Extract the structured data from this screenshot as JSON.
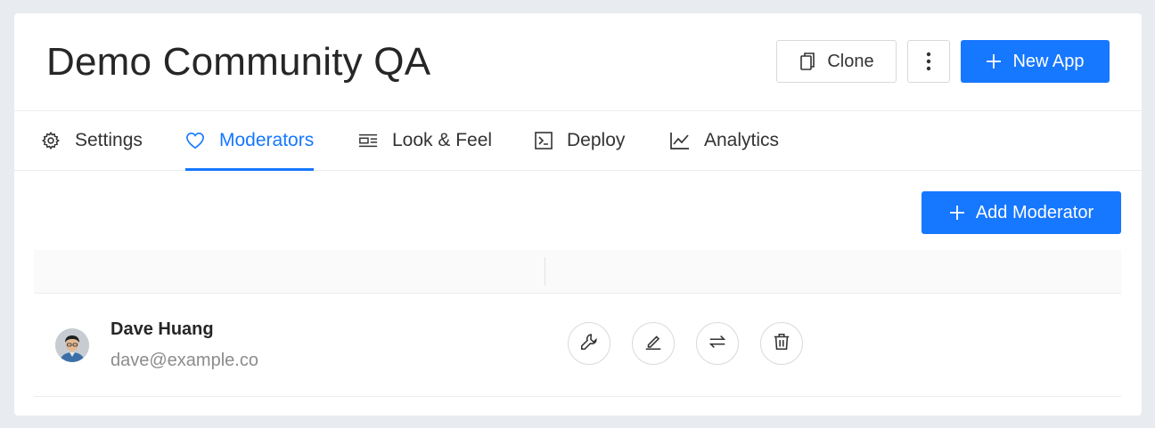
{
  "app": {
    "title": "Demo Community QA"
  },
  "toolbar": {
    "clone_label": "Clone",
    "clone_icon": "copy-icon",
    "more_icon": "more-vertical-icon",
    "new_app_label": "New App",
    "new_app_icon": "plus-icon"
  },
  "tabs": [
    {
      "label": "Settings",
      "icon": "gear-icon",
      "active": false
    },
    {
      "label": "Moderators",
      "icon": "heart-icon",
      "active": true
    },
    {
      "label": "Look & Feel",
      "icon": "layout-icon",
      "active": false
    },
    {
      "label": "Deploy",
      "icon": "terminal-icon",
      "active": false
    },
    {
      "label": "Analytics",
      "icon": "line-chart-icon",
      "active": false
    }
  ],
  "moderators": {
    "add_label": "Add Moderator",
    "rows": [
      {
        "name": "Dave Huang",
        "email": "dave@example.co",
        "actions": [
          "wrench-icon",
          "edit-icon",
          "swap-icon",
          "trash-icon"
        ]
      }
    ]
  },
  "colors": {
    "primary": "#1677ff",
    "text": "#262626",
    "muted": "#8c8c8c",
    "border": "#d9d9d9"
  }
}
